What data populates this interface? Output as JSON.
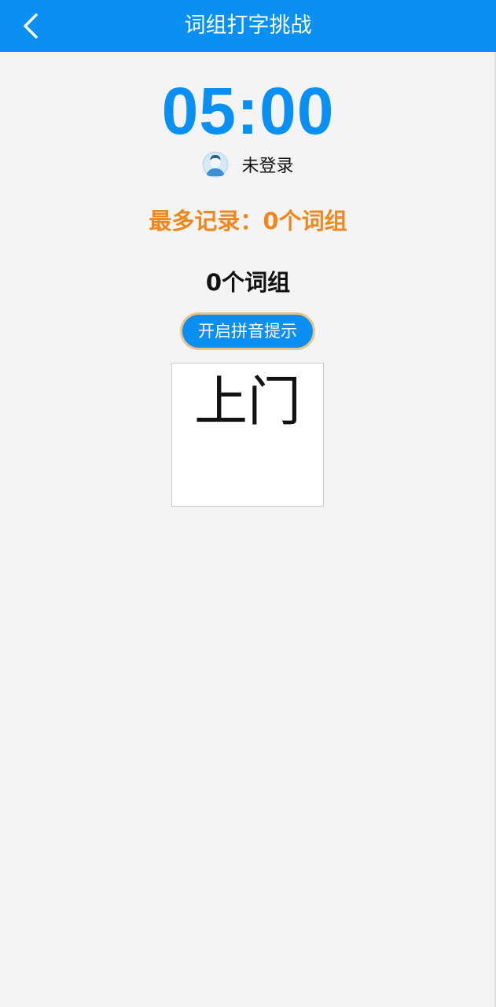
{
  "header": {
    "title": "词组打字挑战",
    "back_icon": "chevron-left-icon",
    "background": "#0a8ff2"
  },
  "timer": {
    "value": "05:00",
    "color": "#0a8ff2"
  },
  "user": {
    "avatar_icon": "user-avatar-icon",
    "name": "未登录"
  },
  "record": {
    "text": "最多记录：0个词组",
    "color": "#f0871c"
  },
  "count": {
    "text": "0个词组"
  },
  "hint_button": {
    "label": "开启拼音提示"
  },
  "word_card": {
    "word": "上门"
  }
}
